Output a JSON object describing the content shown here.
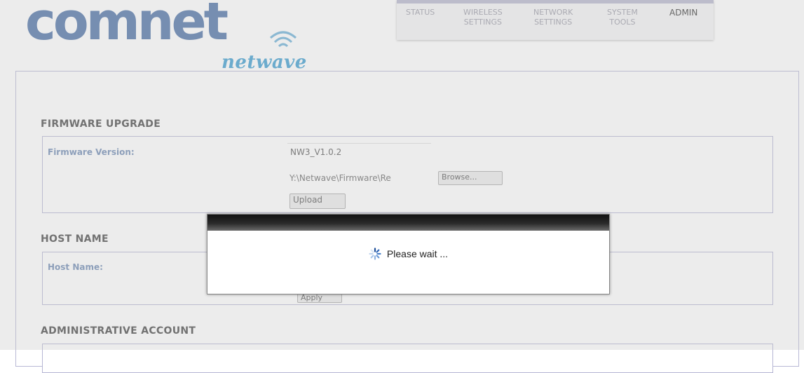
{
  "header": {
    "logo_main": "comnet",
    "logo_sub": "netwave",
    "wifi_icon": "wifi-icon"
  },
  "nav": {
    "items": [
      {
        "line1": "STATUS",
        "line2": ""
      },
      {
        "line1": "WIRELESS",
        "line2": "SETTINGS"
      },
      {
        "line1": "NETWORK",
        "line2": "SETTINGS"
      },
      {
        "line1": "SYSTEM",
        "line2": "TOOLS"
      },
      {
        "line1": "ADMIN",
        "line2": ""
      }
    ],
    "active_index": 4
  },
  "firmware": {
    "title": "FIRMWARE UPGRADE",
    "label": "Firmware Version:",
    "version": "NW3_V1.0.2",
    "file_path": "Y:\\Netwave\\Firmware\\Re",
    "browse_label": "Browse...",
    "upload_label": "Upload"
  },
  "host": {
    "title": "HOST NAME",
    "label": "Host Name:",
    "apply_label": "Apply"
  },
  "admin": {
    "title": "ADMINISTRATIVE ACCOUNT"
  },
  "modal": {
    "message": "Please wait ...",
    "spinner_icon": "spinner-icon"
  },
  "colors": {
    "logo": "#4a6fa5",
    "logo_sub": "#3a9ccf",
    "label": "#6d89b3",
    "border": "#b6b6d4"
  }
}
